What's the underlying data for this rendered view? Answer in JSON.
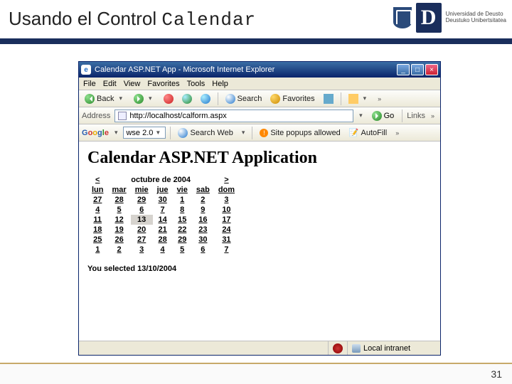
{
  "slide": {
    "title_prefix": "Usando el Control ",
    "title_mono": "Calendar",
    "uni_line1": "Universidad de Deusto",
    "uni_line2": "Deustuko Unibertsitatea",
    "page_number": "31"
  },
  "window": {
    "title": "Calendar ASP.NET App - Microsoft Internet Explorer",
    "min_label": "_",
    "max_label": "□",
    "close_label": "×"
  },
  "menubar": [
    "File",
    "Edit",
    "View",
    "Favorites",
    "Tools",
    "Help"
  ],
  "toolbar": {
    "back": "Back",
    "search": "Search",
    "favorites": "Favorites"
  },
  "addressbar": {
    "label": "Address",
    "url": "http://localhost/calform.aspx",
    "go": "Go",
    "links": "Links"
  },
  "googlebar": {
    "select_value": "wse 2.0",
    "search_web": "Search Web",
    "popups": "Site popups allowed",
    "autofill": "AutoFill"
  },
  "page": {
    "heading": "Calendar ASP.NET Application",
    "selected_text": "You selected 13/10/2004"
  },
  "calendar": {
    "prev": "<",
    "next": ">",
    "title": "octubre de 2004",
    "days": [
      "lun",
      "mar",
      "mie",
      "jue",
      "vie",
      "sab",
      "dom"
    ],
    "weeks": [
      [
        "27",
        "28",
        "29",
        "30",
        "1",
        "2",
        "3"
      ],
      [
        "4",
        "5",
        "6",
        "7",
        "8",
        "9",
        "10"
      ],
      [
        "11",
        "12",
        "13",
        "14",
        "15",
        "16",
        "17"
      ],
      [
        "18",
        "19",
        "20",
        "21",
        "22",
        "23",
        "24"
      ],
      [
        "25",
        "26",
        "27",
        "28",
        "29",
        "30",
        "31"
      ],
      [
        "1",
        "2",
        "3",
        "4",
        "5",
        "6",
        "7"
      ]
    ],
    "selected_row": 2,
    "selected_col": 2
  },
  "statusbar": {
    "zone": "Local intranet"
  }
}
